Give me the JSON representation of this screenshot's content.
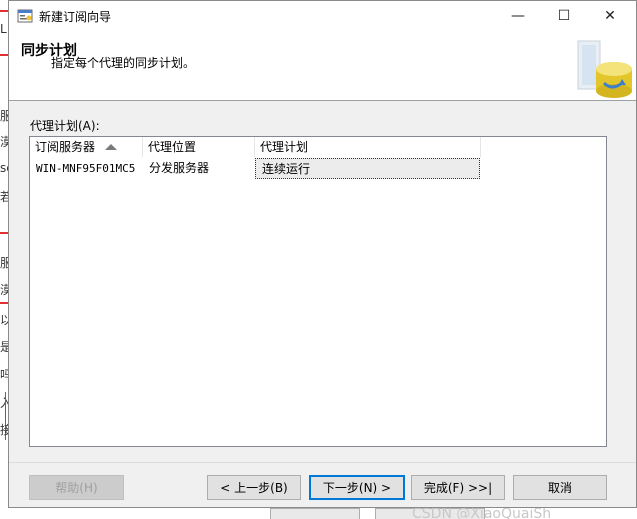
{
  "window": {
    "title": "新建订阅向导",
    "controls": {
      "minimize": "—",
      "maximize": "☐",
      "close": "✕"
    }
  },
  "header": {
    "title": "同步计划",
    "subtitle": "指定每个代理的同步计划。"
  },
  "section": {
    "label": "代理计划(A):"
  },
  "table": {
    "columns": [
      "订阅服务器",
      "代理位置",
      "代理计划"
    ],
    "rows": [
      {
        "subscriber": "WIN-MNF95F01MC5",
        "location": "分发服务器",
        "schedule": "连续运行"
      }
    ]
  },
  "buttons": {
    "help": "帮助(H)",
    "back": "< 上一步(B)",
    "next": "下一步(N) >",
    "finish": "完成(F) >>|",
    "cancel": "取消"
  },
  "background": {
    "marks": [
      "L",
      "服",
      "漠",
      "sc",
      "若",
      "服",
      "漠",
      "以",
      "是",
      "吗",
      "入",
      "接"
    ],
    "watermark": "CSDN @XiaoQuaiSh"
  },
  "colors": {
    "accent": "#0078d7",
    "selection_bg": "#ececec",
    "dialog_bg": "#f0f0f0",
    "background_red": "#e03030"
  },
  "icons": {
    "app": "wizard-app-icon",
    "header": "database-replication-icon",
    "sort": "sort-ascending-icon"
  }
}
